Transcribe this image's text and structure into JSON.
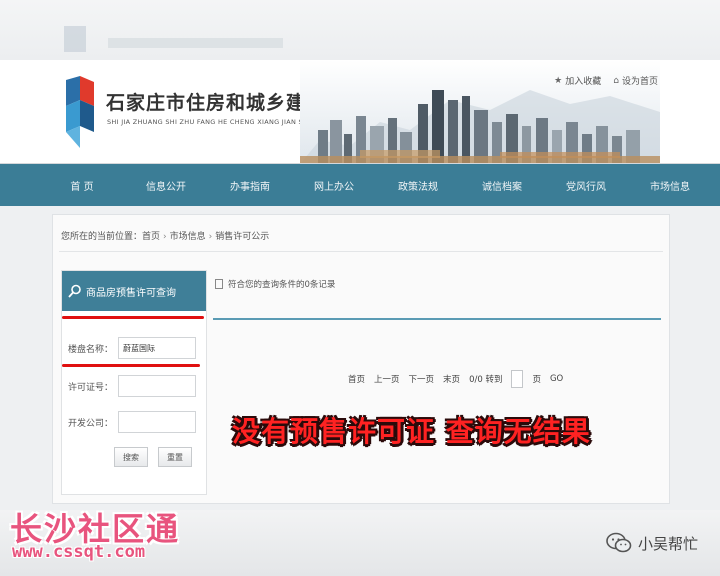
{
  "header": {
    "site_name": "石家庄市住房和城乡建设局",
    "site_pinyin": "SHI JIA ZHUANG SHI ZHU FANG HE CHENG XIANG JIAN SHE JU",
    "top_links": [
      "加入收藏",
      "设为首页"
    ]
  },
  "nav": {
    "items": [
      "首 页",
      "信息公开",
      "办事指南",
      "网上办公",
      "政策法规",
      "诚信档案",
      "党风行风",
      "市场信息"
    ]
  },
  "breadcrumb": {
    "prefix": "您所在的当前位置：",
    "items": [
      "首页",
      "市场信息",
      "销售许可公示"
    ]
  },
  "query_panel": {
    "title": "商品房预售许可查询",
    "fields": [
      {
        "label": "楼盘名称：",
        "value": "蔚蓝国际"
      },
      {
        "label": "许可证号：",
        "value": ""
      },
      {
        "label": "开发公司：",
        "value": ""
      }
    ],
    "search_button": "搜索",
    "reset_button": "重置"
  },
  "results": {
    "summary": "符合您的查询条件的0条记录",
    "pager": {
      "first": "首页",
      "prev": "上一页",
      "next": "下一页",
      "last": "末页",
      "page_info": "0/0 转到",
      "page_suffix": "页",
      "go": "GO"
    }
  },
  "overlay_caption": "没有预售许可证  查询无结果",
  "watermark": {
    "brand": "长沙社区通",
    "url": "www.cssqt.com",
    "wechat_account": "小吴帮忙"
  },
  "colors": {
    "nav_bg": "#3b7d96",
    "panel_head": "#3f7f98",
    "annotation_red": "#e01010",
    "caption_red": "#ff2222",
    "watermark_pink": "#e8547e"
  },
  "icons": {
    "logo": "city-bureau-logo",
    "top_link_1": "star-icon",
    "top_link_2": "home-icon",
    "panel": "magnifier-icon",
    "result": "document-icon",
    "wechat": "wechat-icon"
  }
}
